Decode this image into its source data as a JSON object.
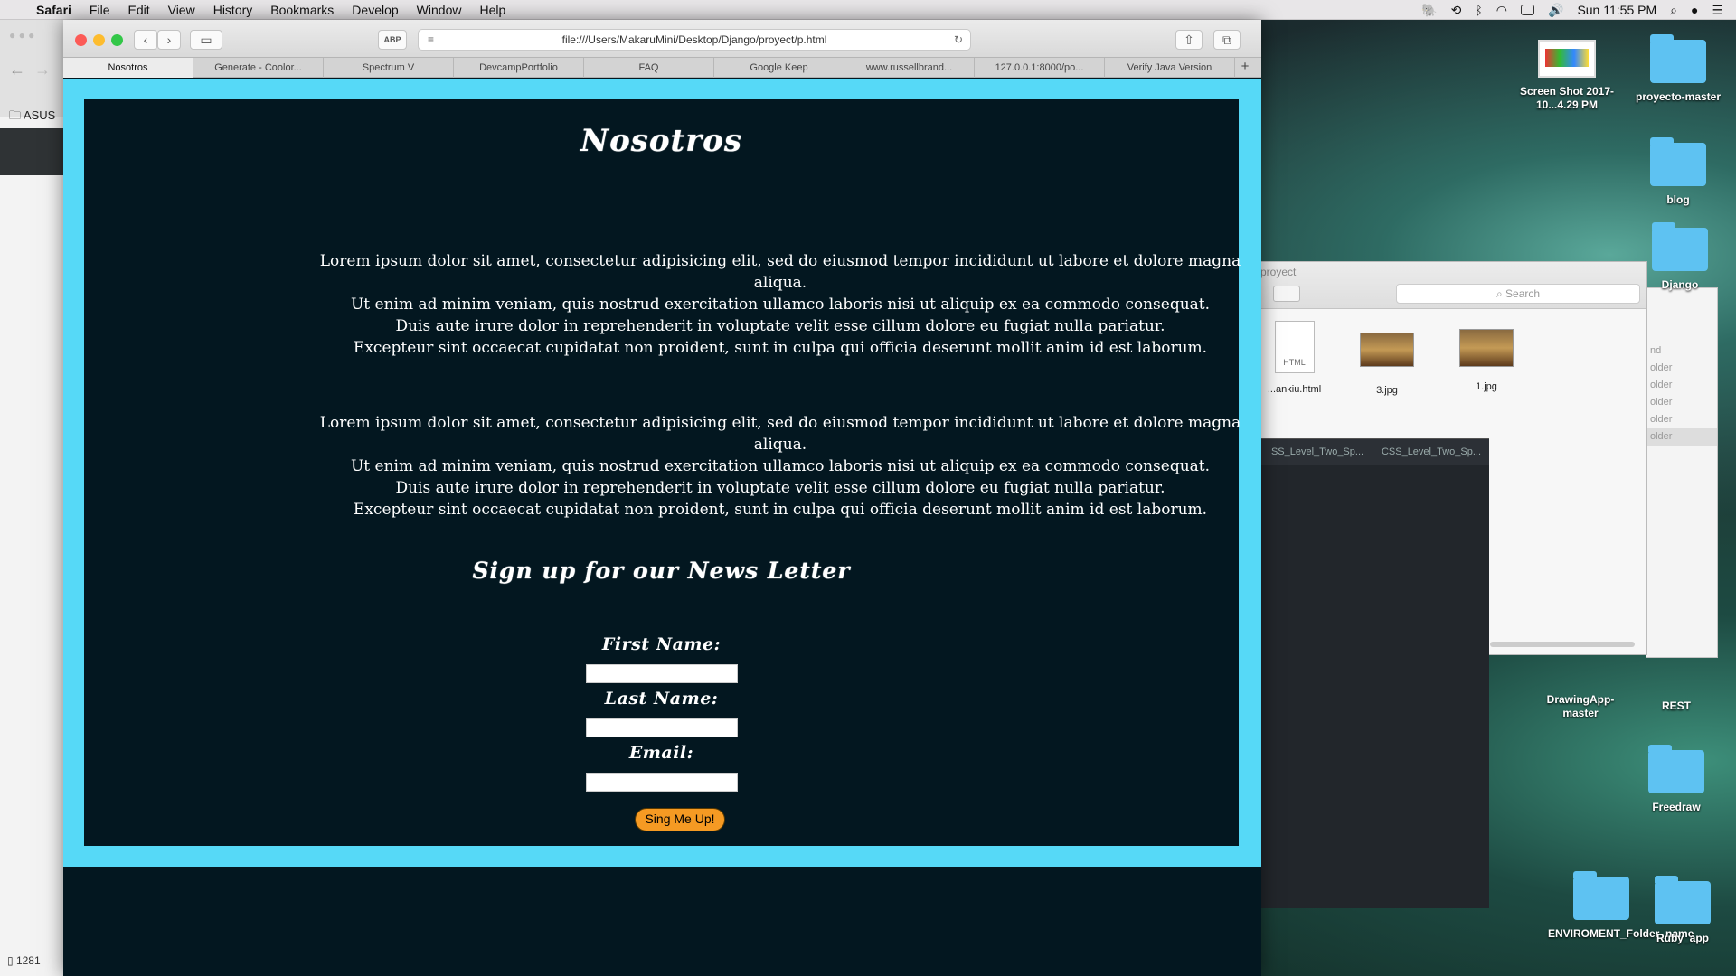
{
  "menubar": {
    "app": "Safari",
    "items": [
      "File",
      "Edit",
      "View",
      "History",
      "Bookmarks",
      "Develop",
      "Window",
      "Help"
    ],
    "clock": "Sun 11:55 PM"
  },
  "bg_window": {
    "favorite": "ASUS",
    "download": "1281"
  },
  "browser": {
    "url": "file:///Users/MakaruMini/Desktop/Django/proyect/p.html",
    "abp_label": "ABP",
    "tabs": [
      "Nosotros",
      "Generate - Coolor...",
      "Spectrum V",
      "DevcampPortfolio",
      "FAQ",
      "Google Keep",
      "www.russellbrand...",
      "127.0.0.1:8000/po...",
      "Verify Java Version"
    ],
    "new_tab": "+"
  },
  "page": {
    "title": "Nosotros",
    "paragraph1": [
      "Lorem ipsum dolor sit amet, consectetur adipisicing elit, sed do eiusmod tempor incididunt ut labore et dolore magna aliqua.",
      "Ut enim ad minim veniam, quis nostrud exercitation ullamco laboris nisi ut aliquip ex ea commodo consequat.",
      "Duis aute irure dolor in reprehenderit in voluptate velit esse cillum dolore eu fugiat nulla pariatur.",
      "Excepteur sint occaecat cupidatat non proident, sunt in culpa qui officia deserunt mollit anim id est laborum."
    ],
    "paragraph2": [
      "Lorem ipsum dolor sit amet, consectetur adipisicing elit, sed do eiusmod tempor incididunt ut labore et dolore magna aliqua.",
      "Ut enim ad minim veniam, quis nostrud exercitation ullamco laboris nisi ut aliquip ex ea commodo consequat.",
      "Duis aute irure dolor in reprehenderit in voluptate velit esse cillum dolore eu fugiat nulla pariatur.",
      "Excepteur sint occaecat cupidatat non proident, sunt in culpa qui officia deserunt mollit anim id est laborum."
    ],
    "newsletter_title": "Sign up for our News Letter",
    "first_name_label": "First Name:",
    "last_name_label": "Last Name:",
    "email_label": "Email:",
    "submit_label": "Sing Me Up!",
    "colors": {
      "frame": "#56d9f7",
      "background": "#031720",
      "button": "#f59a23"
    }
  },
  "finder": {
    "title": "proyect",
    "search_placeholder": "Search",
    "files": [
      {
        "name": "...ankiu.html",
        "kind": "HTML"
      },
      {
        "name": "3.jpg"
      },
      {
        "name": "1.jpg"
      }
    ],
    "list_header": "nd",
    "list_rows": [
      "older",
      "older",
      "older",
      "older",
      "older"
    ]
  },
  "editor": {
    "tabs": [
      "SS_Level_Two_Sp...",
      "CSS_Level_Two_Sp..."
    ]
  },
  "desktop": {
    "icons": [
      {
        "label": "Screen Shot 2017-10...4.29 PM",
        "kind": "screenshot"
      },
      {
        "label": "proyecto-master",
        "kind": "folder"
      },
      {
        "label": "blog",
        "kind": "folder"
      },
      {
        "label": "Django",
        "kind": "folder"
      },
      {
        "label": "DrawingApp-master",
        "kind": "folder"
      },
      {
        "label": "REST",
        "kind": "folder"
      },
      {
        "label": "Freedraw",
        "kind": "folder"
      },
      {
        "label": "ENVIROMENT_Folder_name",
        "kind": "folder"
      },
      {
        "label": "Ruby_app",
        "kind": "folder"
      }
    ]
  }
}
